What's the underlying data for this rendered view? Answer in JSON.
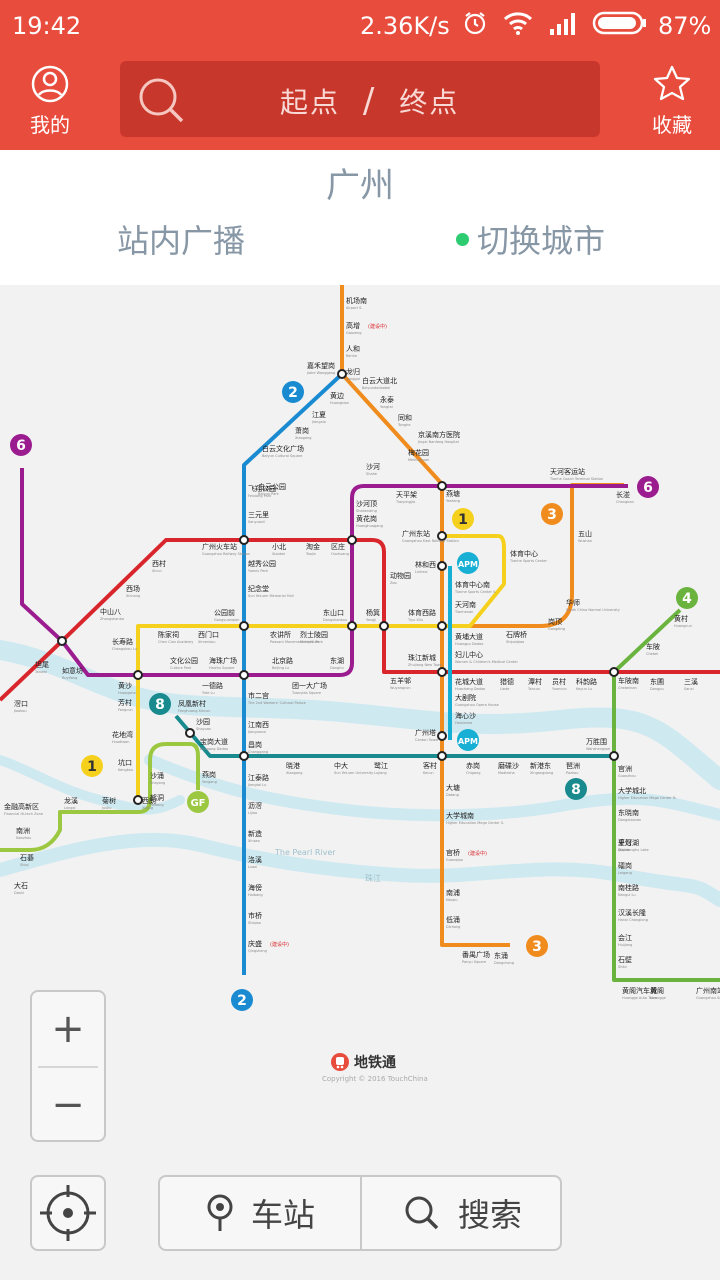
{
  "status": {
    "time": "19:42",
    "net_speed": "2.36K/s",
    "battery": "87%"
  },
  "header": {
    "me_label": "我的",
    "favorites_label": "收藏",
    "origin_placeholder": "起点",
    "separator": "/",
    "destination_placeholder": "终点"
  },
  "city": {
    "name": "广州",
    "broadcast_label": "站内广播",
    "switch_label": "切换城市"
  },
  "map": {
    "lines": [
      {
        "id": "1",
        "color": "#f5d11e"
      },
      {
        "id": "2",
        "color": "#1b8bd1"
      },
      {
        "id": "3",
        "color": "#f08c1e"
      },
      {
        "id": "4",
        "color": "#6ab33e"
      },
      {
        "id": "5",
        "color": "#d9262c"
      },
      {
        "id": "6",
        "color": "#9b1c8f"
      },
      {
        "id": "8",
        "color": "#198a8e"
      },
      {
        "id": "GF",
        "color": "#9cc841"
      },
      {
        "id": "APM",
        "color": "#17b0d4"
      }
    ],
    "river_name_en": "The Pearl River",
    "river_name_zh": "珠江",
    "stations": [
      {
        "zh": "机场南",
        "en": "Airport S."
      },
      {
        "zh": "高增",
        "en": "Gaozeng",
        "note": "(建设中)"
      },
      {
        "zh": "人和",
        "en": "Renhe"
      },
      {
        "zh": "龙归",
        "en": "Longgui"
      },
      {
        "zh": "嘉禾望岗",
        "en": "Jiahe Wanggang"
      },
      {
        "zh": "黄边",
        "en": "Huangbian"
      },
      {
        "zh": "白云大道北",
        "en": "Baiyundadaobei"
      },
      {
        "zh": "江夏",
        "en": "Jiangxia"
      },
      {
        "zh": "永泰",
        "en": "Yongtai"
      },
      {
        "zh": "萧岗",
        "en": "Xiaogang"
      },
      {
        "zh": "同和",
        "en": "Tonghe"
      },
      {
        "zh": "白云文化广场",
        "en": "Baiyun Cultural Square"
      },
      {
        "zh": "京溪南方医院",
        "en": "Jingxi Nanfang Hospital"
      },
      {
        "zh": "白云公园",
        "en": "Baiyun Park"
      },
      {
        "zh": "梅花园",
        "en": "Meihuayuan"
      },
      {
        "zh": "飞翔公园",
        "en": "Feixiang Park"
      },
      {
        "zh": "沙河",
        "en": "Shahe"
      },
      {
        "zh": "天河客运站",
        "en": "Tianhe Coach Terminal Station"
      },
      {
        "zh": "燕塘",
        "en": "Yantang"
      },
      {
        "zh": "天平架",
        "en": "Tianpingjia"
      },
      {
        "zh": "沙河顶",
        "en": "Shahending"
      },
      {
        "zh": "三元里",
        "en": "Sanyuanli"
      },
      {
        "zh": "长湴",
        "en": "Changban"
      },
      {
        "zh": "黄花岗",
        "en": "Huanghuagang"
      },
      {
        "zh": "广州东站",
        "en": "Guangzhou East Railway Station"
      },
      {
        "zh": "五山",
        "en": "Wushan"
      },
      {
        "zh": "广州火车站",
        "en": "Guangzhou Railway Station"
      },
      {
        "zh": "小北",
        "en": "Xiaobei"
      },
      {
        "zh": "淘金",
        "en": "Taojin"
      },
      {
        "zh": "区庄",
        "en": "Ouzhuang"
      },
      {
        "zh": "体育中心",
        "en": "Tianhe Sports Center"
      },
      {
        "zh": "越秀公园",
        "en": "Yuexiu Park"
      },
      {
        "zh": "动物园",
        "en": "Zoo"
      },
      {
        "zh": "林和西",
        "en": "Linhexi"
      },
      {
        "zh": "西村",
        "en": "Xicun"
      },
      {
        "zh": "体育中心南",
        "en": "Tianhe Sports Center S."
      },
      {
        "zh": "纪念堂",
        "en": "Sun Yat-sen Memorial Hall"
      },
      {
        "zh": "华师",
        "en": "South China Normal University"
      },
      {
        "zh": "西场",
        "en": "Xichang"
      },
      {
        "zh": "天河南",
        "en": "Tianhenan"
      },
      {
        "zh": "中山八",
        "en": "Zhongshanba"
      },
      {
        "zh": "公园前",
        "en": "Gongyuanqian"
      },
      {
        "zh": "东山口",
        "en": "Dongshankou"
      },
      {
        "zh": "杨箕",
        "en": "Yangji"
      },
      {
        "zh": "体育西路",
        "en": "Tiyu Xilu"
      },
      {
        "zh": "长寿路",
        "en": "Changshou Lu"
      },
      {
        "zh": "陈家祠",
        "en": "Chen Clan Academy"
      },
      {
        "zh": "西门口",
        "en": "Ximenkou"
      },
      {
        "zh": "农讲所",
        "en": "Peasant Movement Institute"
      },
      {
        "zh": "烈士陵园",
        "en": "Martyrs' Park"
      },
      {
        "zh": "黄埔大道",
        "en": "Huangpu Dadao"
      },
      {
        "zh": "石牌桥",
        "en": "Shipaiqiao"
      },
      {
        "zh": "岗顶",
        "en": "Gangding"
      },
      {
        "zh": "坦尾",
        "en": "Tanwei"
      },
      {
        "zh": "文化公园",
        "en": "Culture Park"
      },
      {
        "zh": "海珠广场",
        "en": "Haizhu Square"
      },
      {
        "zh": "北京路",
        "en": "Beijing Lu"
      },
      {
        "zh": "东湖",
        "en": "Donghu"
      },
      {
        "zh": "五羊邨",
        "en": "Wuyangcun"
      },
      {
        "zh": "妇儿中心",
        "en": "Women & Children's Medical Center"
      },
      {
        "zh": "如意坊",
        "en": "Ruyifang"
      },
      {
        "zh": "珠江新城",
        "en": "Zhujiang New Town"
      },
      {
        "zh": "花城大道",
        "en": "Huacheng Dadao"
      },
      {
        "zh": "猎德",
        "en": "Liede"
      },
      {
        "zh": "潭村",
        "en": "Tancun"
      },
      {
        "zh": "员村",
        "en": "Yuancun"
      },
      {
        "zh": "科韵路",
        "en": "Keyun Lu"
      },
      {
        "zh": "车陂南",
        "en": "Chebeinan"
      },
      {
        "zh": "东圃",
        "en": "Dongpu"
      },
      {
        "zh": "三溪",
        "en": "Sanxi"
      },
      {
        "zh": "黄村",
        "en": "Huangcun"
      },
      {
        "zh": "车陂",
        "en": "Chebei"
      },
      {
        "zh": "滘口",
        "en": "Jiaokou"
      },
      {
        "zh": "黄沙",
        "en": "Huangsha"
      },
      {
        "zh": "一德路",
        "en": "Yide Lu"
      },
      {
        "zh": "团一大广场",
        "en": "Tuanyida Square"
      },
      {
        "zh": "大剧院",
        "en": "Guangzhou Opera House"
      },
      {
        "zh": "芳村",
        "en": "Fangcun"
      },
      {
        "zh": "市二宫",
        "en": "The 2nd Workers' Cultural Palace"
      },
      {
        "zh": "海心沙",
        "en": "Haixinsha"
      },
      {
        "zh": "凤凰新村",
        "en": "Fenghuang Xincun"
      },
      {
        "zh": "广州塔",
        "en": "Canton Tower"
      },
      {
        "zh": "花地湾",
        "en": "Huadiwan"
      },
      {
        "zh": "沙园",
        "en": "Shayuan"
      },
      {
        "zh": "宝岗大道",
        "en": "Baogang Dadao"
      },
      {
        "zh": "江南西",
        "en": "Jiangnanxi"
      },
      {
        "zh": "昌岗",
        "en": "Changgang"
      },
      {
        "zh": "晓港",
        "en": "Xiaogang"
      },
      {
        "zh": "中大",
        "en": "Sun Yat-sen University"
      },
      {
        "zh": "鹭江",
        "en": "Lujiang"
      },
      {
        "zh": "客村",
        "en": "Kecun"
      },
      {
        "zh": "赤岗",
        "en": "Chigang"
      },
      {
        "zh": "磨碟沙",
        "en": "Modiesha"
      },
      {
        "zh": "新港东",
        "en": "Xingangdong"
      },
      {
        "zh": "琶洲",
        "en": "Pazhou"
      },
      {
        "zh": "万胜围",
        "en": "Wanshengwei"
      },
      {
        "zh": "坑口",
        "en": "Kengkou"
      },
      {
        "zh": "沙涌",
        "en": "Shayong"
      },
      {
        "zh": "鹤洞",
        "en": "Hedong"
      },
      {
        "zh": "燕岗",
        "en": "Yangang"
      },
      {
        "zh": "官洲",
        "en": "Guanzhou"
      },
      {
        "zh": "西朗",
        "en": "Xilang"
      },
      {
        "zh": "菊树",
        "en": "Jushu"
      },
      {
        "zh": "龙溪",
        "en": "Longxi"
      },
      {
        "zh": "江泰路",
        "en": "Jiangtai Lu"
      },
      {
        "zh": "大塘",
        "en": "Datang"
      },
      {
        "zh": "大学城北",
        "en": "Higher Education Mega Center N."
      },
      {
        "zh": "金融高新区",
        "en": "Financial Hi-tech Zone"
      },
      {
        "zh": "东晓南",
        "en": "Dongxiaonan"
      },
      {
        "zh": "沥滘",
        "en": "Lijiao"
      },
      {
        "zh": "大学城南",
        "en": "Higher Education Mega Center S."
      },
      {
        "zh": "千灯湖",
        "en": "Qiandenghu Lake"
      },
      {
        "zh": "南洲",
        "en": "Nanzhou"
      },
      {
        "zh": "新造",
        "en": "Xinzao"
      },
      {
        "zh": "夏滘",
        "en": "Xiajiao"
      },
      {
        "zh": "官桥",
        "en": "Guanqiao",
        "note": "(建设中)"
      },
      {
        "zh": "礌岗",
        "en": "Leigang"
      },
      {
        "zh": "洛溪",
        "en": "Luoxi"
      },
      {
        "zh": "石碁",
        "en": "Shiqi"
      },
      {
        "zh": "南桂路",
        "en": "Nangui Lu"
      },
      {
        "zh": "大石",
        "en": "Dashi"
      },
      {
        "zh": "南浦",
        "en": "Nanpu"
      },
      {
        "zh": "海傍",
        "en": "Haibang"
      },
      {
        "zh": "汉溪长隆",
        "en": "Hanxi Changlong"
      },
      {
        "zh": "低涌",
        "en": "Dichong"
      },
      {
        "zh": "会江",
        "en": "Huijiang"
      },
      {
        "zh": "市桥",
        "en": "Shiqiao"
      },
      {
        "zh": "番禺广场",
        "en": "Panyu Square"
      },
      {
        "zh": "东涌",
        "en": "Dongchong"
      },
      {
        "zh": "石壁",
        "en": "Shibi"
      },
      {
        "zh": "庆盛",
        "en": "Qingsheng",
        "note": "(建设中)"
      },
      {
        "zh": "黄阁汽车城",
        "en": "Huangge Auto Town"
      },
      {
        "zh": "黄阁",
        "en": "Huangge"
      },
      {
        "zh": "广州南站",
        "en": "Guangzhou South Railway Station"
      }
    ]
  },
  "controls": {
    "zoom_in": "+",
    "zoom_out": "−",
    "station_label": "车站",
    "search_label": "搜索"
  },
  "brand": {
    "name": "地铁通",
    "copyright": "Copyright © 2016 TouchChina"
  },
  "colors": {
    "accent": "#e84c3d",
    "muted_text": "#8797a5"
  }
}
